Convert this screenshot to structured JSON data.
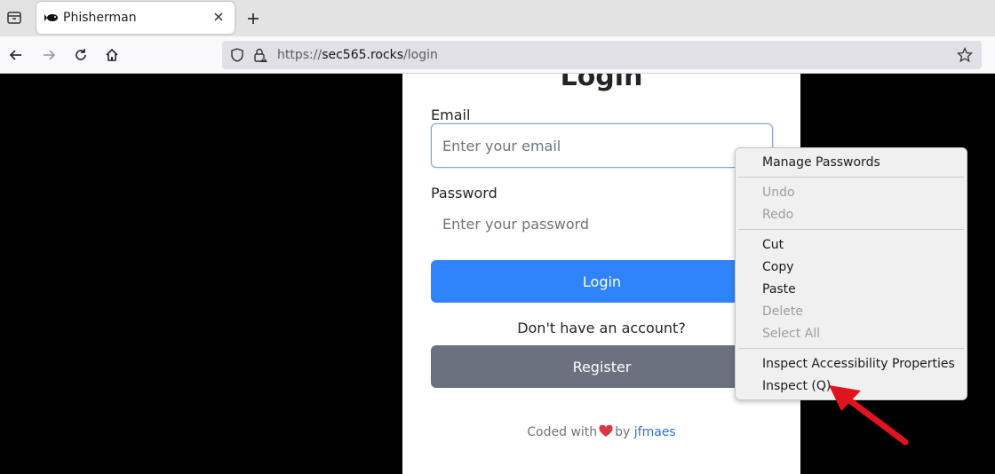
{
  "browser": {
    "tab_title": "Phisherman",
    "url_scheme": "https://",
    "url_host": "sec565.rocks",
    "url_path": "/login"
  },
  "page": {
    "heading": "Login",
    "email_label": "Email",
    "email_placeholder": "Enter your email",
    "password_label": "Password",
    "password_placeholder": "Enter your password",
    "login_button": "Login",
    "no_account_text": "Don't have an account?",
    "register_button": "Register",
    "footer_prefix": "Coded with",
    "footer_by": "by",
    "footer_author": "jfmaes"
  },
  "context_menu": {
    "manage_passwords": "Manage Passwords",
    "undo": "Undo",
    "redo": "Redo",
    "cut": "Cut",
    "copy": "Copy",
    "paste": "Paste",
    "delete": "Delete",
    "select_all": "Select All",
    "inspect_accessibility": "Inspect Accessibility Properties",
    "inspect": "Inspect (Q)"
  },
  "colors": {
    "login_button": "#2f84fb",
    "register_button": "#6c7180",
    "heart": "#dc3545",
    "annotation_arrow": "#e0141e"
  },
  "icons": [
    "tab-list-icon",
    "fish-favicon-icon",
    "close-icon",
    "plus-icon",
    "back-arrow-icon",
    "forward-arrow-icon",
    "reload-icon",
    "home-icon",
    "shield-icon",
    "lock-icon",
    "star-icon",
    "heart-icon"
  ]
}
